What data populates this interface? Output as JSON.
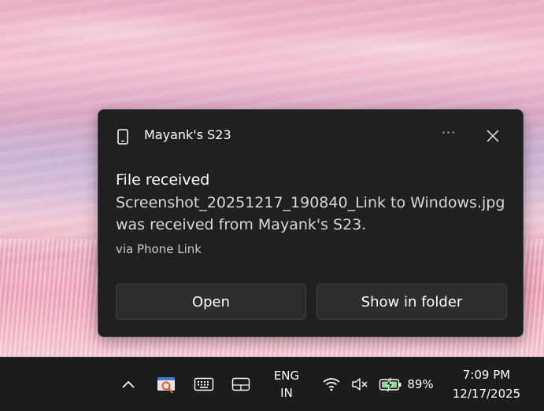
{
  "notification": {
    "device_name": "Mayank's S23",
    "more_label": "···",
    "title": "File received",
    "body": "Screenshot_20251217_190840_Link to Windows.jpg was received from Mayank's S23.",
    "attribution": "via Phone Link",
    "actions": {
      "open": "Open",
      "show_in_folder": "Show in folder"
    }
  },
  "taskbar": {
    "language_line1": "ENG",
    "language_line2": "IN",
    "battery_percent": "89%",
    "time": "7:09 PM",
    "date": "12/17/2025"
  },
  "colors": {
    "toast_bg": "#202020",
    "button_bg": "#2d2d2d",
    "taskbar_bg": "#1c1c1c",
    "battery_green": "#7be37b"
  },
  "icons": [
    "phone-icon",
    "more-icon",
    "close-icon",
    "chevron-up-icon",
    "app-icon",
    "keyboard-icon",
    "tablet-mode-icon",
    "wifi-icon",
    "volume-muted-icon",
    "battery-charging-icon"
  ]
}
